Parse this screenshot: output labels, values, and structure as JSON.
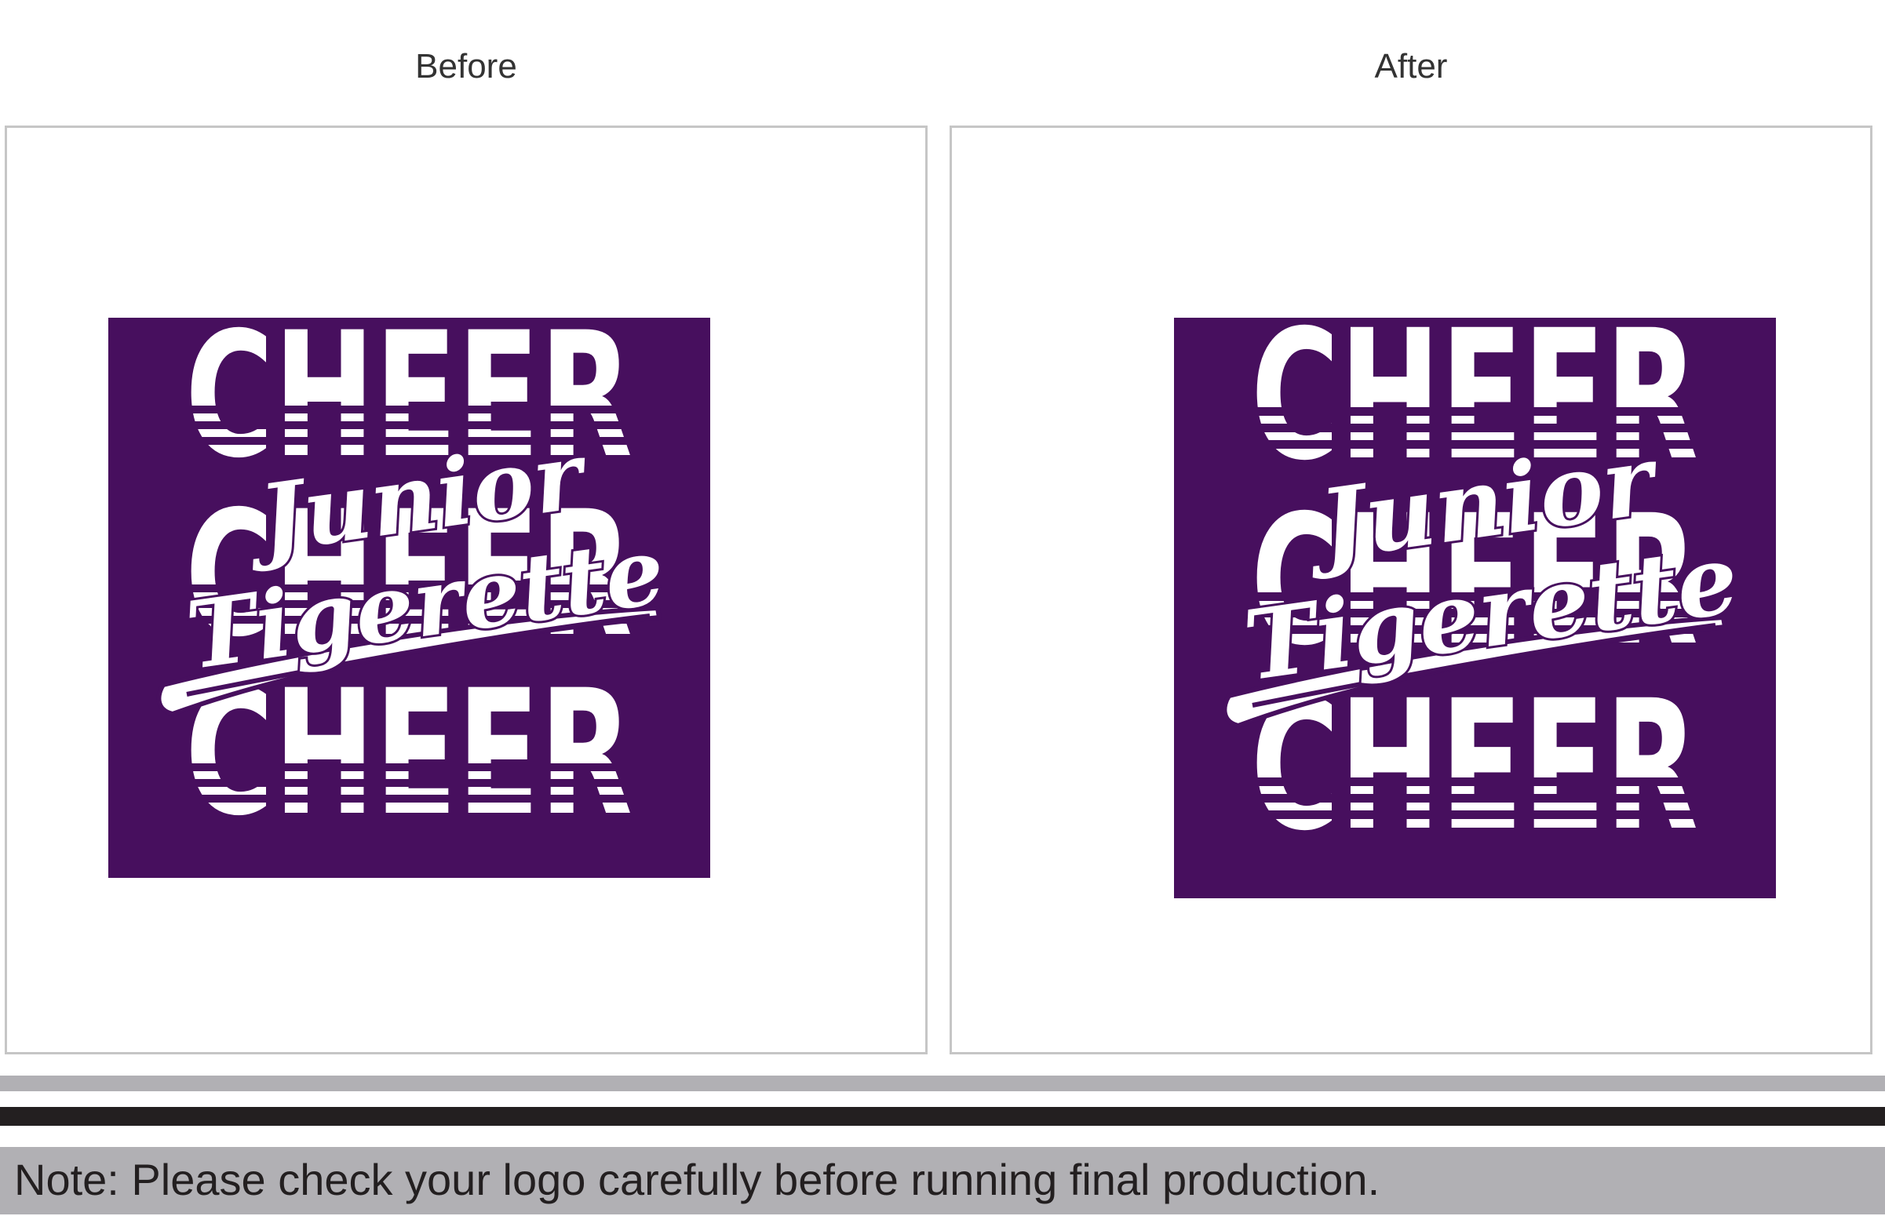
{
  "panels": {
    "before": {
      "title": "Before"
    },
    "after": {
      "title": "After"
    }
  },
  "artwork": {
    "background_color": "#470f5e",
    "ink_color": "#ffffff",
    "cheer_text": "CHEER",
    "script_line_1": "Junior",
    "script_line_2": "Tigerette"
  },
  "footer": {
    "note": "Note: Please check your logo carefully before running final production."
  }
}
